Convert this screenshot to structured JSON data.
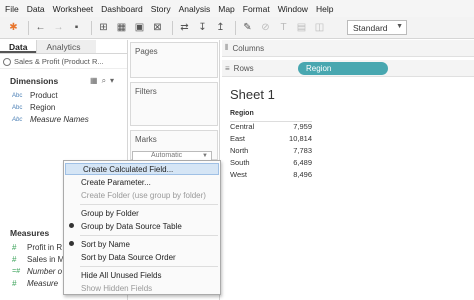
{
  "menu": [
    "File",
    "Data",
    "Worksheet",
    "Dashboard",
    "Story",
    "Analysis",
    "Map",
    "Format",
    "Window",
    "Help"
  ],
  "toolbar": {
    "view_mode": "Standard",
    "icons": [
      "tableau-logo-icon",
      "undo-icon",
      "redo-icon",
      "save-icon",
      "add-datasource-icon",
      "new-sheet-icon",
      "duplicate-sheet-icon",
      "clear-sheet-icon",
      "swap-icon",
      "sort-ascending-icon",
      "sort-descending-icon",
      "highlight-icon",
      "group-icon",
      "label-icon",
      "fix-axes-icon",
      "fit-icon"
    ]
  },
  "data_pane": {
    "tab_data": "Data",
    "tab_analytics": "Analytics",
    "datasource": "Sales & Profit (Product R...",
    "dimensions_title": "Dimensions",
    "dimensions": [
      {
        "type": "Abc",
        "label": "Product"
      },
      {
        "type": "Abc",
        "label": "Region"
      },
      {
        "type": "Abc",
        "label": "Measure Names"
      }
    ],
    "measures_title": "Measures",
    "measures": [
      {
        "type": "#",
        "label": "Profit in R"
      },
      {
        "type": "#",
        "label": "Sales in M"
      },
      {
        "type": "=#",
        "label": "Number o"
      },
      {
        "type": "#",
        "label": "Measure"
      }
    ]
  },
  "cards": {
    "pages": "Pages",
    "filters": "Filters",
    "marks": "Marks",
    "marks_type": "Automatic"
  },
  "shelves": {
    "columns": "Columns",
    "rows": "Rows",
    "rows_pill": "Region"
  },
  "sheet": {
    "title": "Sheet 1",
    "header": "Region",
    "rows": [
      {
        "region": "Central",
        "value": "7,959"
      },
      {
        "region": "East",
        "value": "10,814"
      },
      {
        "region": "North",
        "value": "7,783"
      },
      {
        "region": "South",
        "value": "6,489"
      },
      {
        "region": "West",
        "value": "8,496"
      }
    ]
  },
  "context_menu": {
    "items": [
      {
        "label": "Create Calculated Field...",
        "state": "highlighted"
      },
      {
        "label": "Create Parameter...",
        "state": "normal"
      },
      {
        "label": "Create Folder (use group by folder)",
        "state": "disabled"
      },
      {
        "label": "Group by Folder",
        "state": "normal"
      },
      {
        "label": "Group by Data Source Table",
        "state": "checked"
      },
      {
        "label": "Sort by Name",
        "state": "checked"
      },
      {
        "label": "Sort by Data Source Order",
        "state": "normal"
      },
      {
        "label": "Hide All Unused Fields",
        "state": "normal"
      },
      {
        "label": "Show Hidden Fields",
        "state": "disabled"
      }
    ]
  }
}
